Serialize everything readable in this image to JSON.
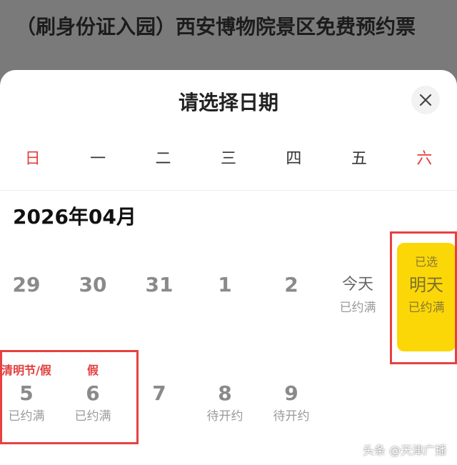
{
  "page_title": "（刷身份证入园）西安博物院景区免费预约票",
  "sheet": {
    "title": "请选择日期",
    "close_icon": "close-icon"
  },
  "weekdays": [
    "日",
    "一",
    "二",
    "三",
    "四",
    "五",
    "六"
  ],
  "month_label": "2026年04月",
  "week1": [
    {
      "top": "",
      "num": "29",
      "status": ""
    },
    {
      "top": "",
      "num": "30",
      "status": ""
    },
    {
      "top": "",
      "num": "31",
      "status": ""
    },
    {
      "top": "",
      "num": "1",
      "status": ""
    },
    {
      "top": "",
      "num": "2",
      "status": ""
    },
    {
      "top": "",
      "num": "今天",
      "status": "已约满"
    },
    {
      "top": "已选",
      "num": "明天",
      "status": "已约满"
    }
  ],
  "week2": [
    {
      "top": "清明节/假",
      "num": "5",
      "status": "已约满"
    },
    {
      "top": "假",
      "num": "6",
      "status": "已约满"
    },
    {
      "top": "",
      "num": "7",
      "status": ""
    },
    {
      "top": "",
      "num": "8",
      "status": "待开约"
    },
    {
      "top": "",
      "num": "9",
      "status": "待开约"
    }
  ],
  "watermark": "头条 @天津广播",
  "colors": {
    "weekend": "#e23d3d",
    "selected": "#fcd708",
    "highlight_box": "#e84040"
  }
}
